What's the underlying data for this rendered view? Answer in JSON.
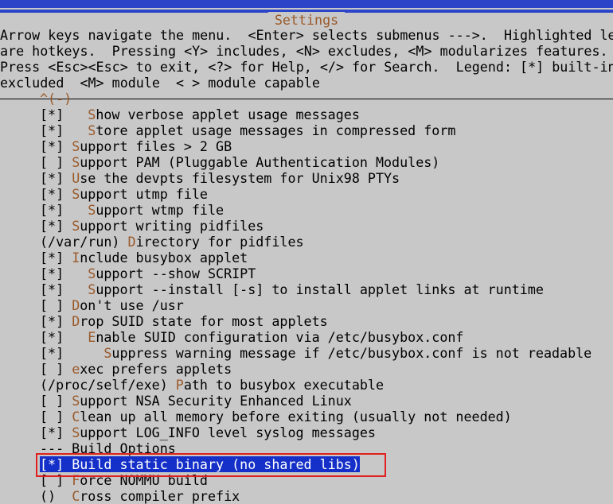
{
  "title": "Settings",
  "help_lines": [
    "Arrow keys navigate the menu.  <Enter> selects submenus --->.  Highlighted le",
    "are hotkeys.  Pressing <Y> includes, <N> excludes, <M> modularizes features.",
    "Press <Esc><Esc> to exit, <?> for Help, </> for Search.  Legend: [*] built-in",
    "excluded  <M> module  < > module capable"
  ],
  "scroll_indicator": "^(-)",
  "items": [
    {
      "prefix": "[*]   ",
      "hot": "S",
      "rest": "how verbose applet usage messages"
    },
    {
      "prefix": "[*]   ",
      "hot": "S",
      "rest": "tore applet usage messages in compressed form"
    },
    {
      "prefix": "[*] ",
      "hot": "S",
      "rest": "upport files > 2 GB"
    },
    {
      "prefix": "[ ] ",
      "hot": "S",
      "rest": "upport PAM (Pluggable Authentication Modules)"
    },
    {
      "prefix": "[*] ",
      "hot": "U",
      "rest": "se the devpts filesystem for Unix98 PTYs"
    },
    {
      "prefix": "[*] ",
      "hot": "S",
      "rest": "upport utmp file"
    },
    {
      "prefix": "[*]   ",
      "hot": "S",
      "rest": "upport wtmp file"
    },
    {
      "prefix": "[*] ",
      "hot": "S",
      "rest": "upport writing pidfiles"
    },
    {
      "prefix": "(/var/run) ",
      "hot": "D",
      "rest": "irectory for pidfiles"
    },
    {
      "prefix": "[*] ",
      "hot": "I",
      "rest": "nclude busybox applet"
    },
    {
      "prefix": "[*]   ",
      "hot": "S",
      "rest": "upport --show SCRIPT"
    },
    {
      "prefix": "[*]   ",
      "hot": "S",
      "rest": "upport --install [-s] to install applet links at runtime"
    },
    {
      "prefix": "[ ] ",
      "hot": "D",
      "rest": "on't use /usr"
    },
    {
      "prefix": "[*] ",
      "hot": "D",
      "rest": "rop SUID state for most applets"
    },
    {
      "prefix": "[*]   ",
      "hot": "E",
      "rest": "nable SUID configuration via /etc/busybox.conf"
    },
    {
      "prefix": "[*]     ",
      "hot": "S",
      "rest": "uppress warning message if /etc/busybox.conf is not readable"
    },
    {
      "prefix": "[ ] ",
      "hot": "e",
      "rest": "xec prefers applets"
    },
    {
      "prefix": "(/proc/self/exe) ",
      "hot": "P",
      "rest": "ath to busybox executable"
    },
    {
      "prefix": "[ ] ",
      "hot": "S",
      "rest": "upport NSA Security Enhanced Linux"
    },
    {
      "prefix": "[ ] ",
      "hot": "C",
      "rest": "lean up all memory before exiting (usually not needed)"
    },
    {
      "prefix": "[*] ",
      "hot": "S",
      "rest": "upport LOG_INFO level syslog messages"
    },
    {
      "prefix": "",
      "hot": "",
      "rest": "--- Build Options"
    },
    {
      "prefix": "[*] ",
      "hot": "B",
      "rest": "uild static binary (no shared libs)",
      "selected": true
    },
    {
      "prefix": "[ ] ",
      "hot": "F",
      "rest": "orce NOMMU build"
    },
    {
      "prefix": "()  ",
      "hot": "C",
      "rest": "ross compiler prefix"
    }
  ]
}
